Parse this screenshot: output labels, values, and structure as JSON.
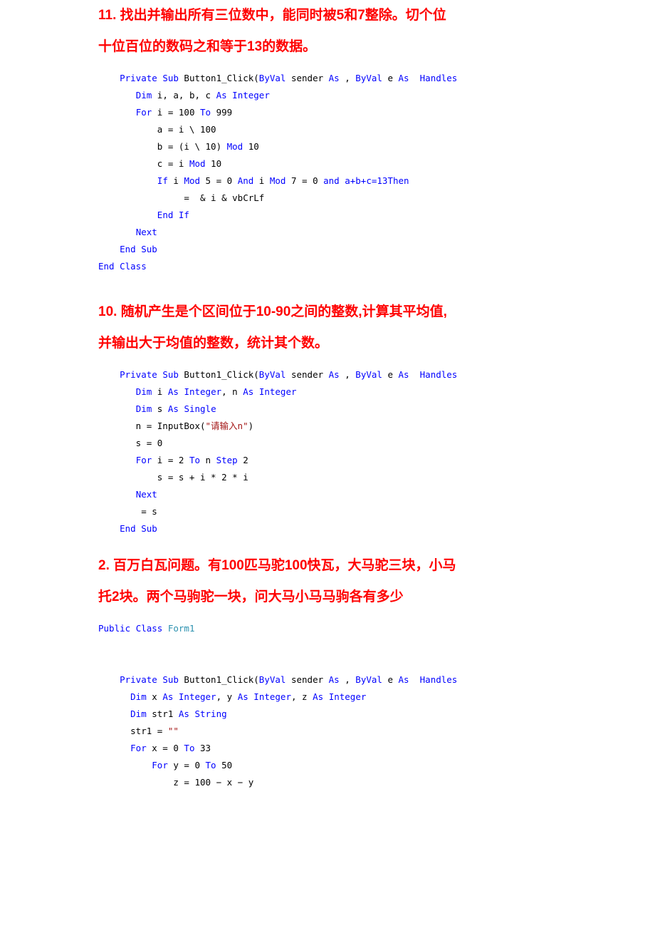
{
  "document": {
    "background": "#ffffff",
    "accent_heading_color": "#FF0000",
    "keyword_color": "#0000FF",
    "type_color": "#2B91AF",
    "string_color": "#A31515"
  },
  "sections": [
    {
      "heading_line1": "11. 找出并输出所有三位数中，能同时被5和7整除。切个位",
      "heading_line2": "十位百位的数码之和等于13的数据。",
      "code_lines": [
        [
          {
            "t": "    ",
            "c": "pl"
          },
          {
            "t": "Private",
            "c": "kw"
          },
          {
            "t": " ",
            "c": "pl"
          },
          {
            "t": "Sub",
            "c": "kw"
          },
          {
            "t": " Button1_Click(",
            "c": "pl"
          },
          {
            "t": "ByVal",
            "c": "kw"
          },
          {
            "t": " sender ",
            "c": "pl"
          },
          {
            "t": "As",
            "c": "kw"
          },
          {
            "t": " , ",
            "c": "pl"
          },
          {
            "t": "ByVal",
            "c": "kw"
          },
          {
            "t": " e ",
            "c": "pl"
          },
          {
            "t": "As",
            "c": "kw"
          },
          {
            "t": "  ",
            "c": "pl"
          },
          {
            "t": "Handles",
            "c": "kw"
          }
        ],
        [
          {
            "t": "       ",
            "c": "pl"
          },
          {
            "t": "Dim",
            "c": "kw"
          },
          {
            "t": " i, a, b, c ",
            "c": "pl"
          },
          {
            "t": "As",
            "c": "kw"
          },
          {
            "t": " ",
            "c": "pl"
          },
          {
            "t": "Integer",
            "c": "kw"
          }
        ],
        [
          {
            "t": "       ",
            "c": "pl"
          },
          {
            "t": "For",
            "c": "kw"
          },
          {
            "t": " i = 100 ",
            "c": "pl"
          },
          {
            "t": "To",
            "c": "kw"
          },
          {
            "t": " 999",
            "c": "pl"
          }
        ],
        [
          {
            "t": "           a = i \\ 100",
            "c": "pl"
          }
        ],
        [
          {
            "t": "           b = (i \\ 10) ",
            "c": "pl"
          },
          {
            "t": "Mod",
            "c": "kw"
          },
          {
            "t": " 10",
            "c": "pl"
          }
        ],
        [
          {
            "t": "           c = i ",
            "c": "pl"
          },
          {
            "t": "Mod",
            "c": "kw"
          },
          {
            "t": " 10",
            "c": "pl"
          }
        ],
        [
          {
            "t": "           ",
            "c": "pl"
          },
          {
            "t": "If",
            "c": "kw"
          },
          {
            "t": " i ",
            "c": "pl"
          },
          {
            "t": "Mod",
            "c": "kw"
          },
          {
            "t": " 5 = 0 ",
            "c": "pl"
          },
          {
            "t": "And",
            "c": "kw"
          },
          {
            "t": " i ",
            "c": "pl"
          },
          {
            "t": "Mod",
            "c": "kw"
          },
          {
            "t": " 7 = 0 ",
            "c": "pl"
          },
          {
            "t": "and",
            "c": "kw"
          },
          {
            "t": " ",
            "c": "pl"
          },
          {
            "t": "a+b+c=13Then",
            "c": "kw"
          }
        ],
        [
          {
            "t": "                =  & i & vbCrLf",
            "c": "pl"
          }
        ],
        [
          {
            "t": "           ",
            "c": "pl"
          },
          {
            "t": "End",
            "c": "kw"
          },
          {
            "t": " ",
            "c": "pl"
          },
          {
            "t": "If",
            "c": "kw"
          }
        ],
        [
          {
            "t": "       ",
            "c": "pl"
          },
          {
            "t": "Next",
            "c": "kw"
          }
        ],
        [
          {
            "t": "    ",
            "c": "pl"
          },
          {
            "t": "End",
            "c": "kw"
          },
          {
            "t": " ",
            "c": "pl"
          },
          {
            "t": "Sub",
            "c": "kw"
          }
        ],
        [
          {
            "t": "End",
            "c": "kw"
          },
          {
            "t": " ",
            "c": "pl"
          },
          {
            "t": "Class",
            "c": "kw"
          }
        ]
      ]
    },
    {
      "heading_line1": "10. 随机产生是个区间位于10-90之间的整数,计算其平均值,",
      "heading_line2": "并输出大于均值的整数，统计其个数。",
      "code_lines": [
        [
          {
            "t": "    ",
            "c": "pl"
          },
          {
            "t": "Private",
            "c": "kw"
          },
          {
            "t": " ",
            "c": "pl"
          },
          {
            "t": "Sub",
            "c": "kw"
          },
          {
            "t": " Button1_Click(",
            "c": "pl"
          },
          {
            "t": "ByVal",
            "c": "kw"
          },
          {
            "t": " sender ",
            "c": "pl"
          },
          {
            "t": "As",
            "c": "kw"
          },
          {
            "t": " , ",
            "c": "pl"
          },
          {
            "t": "ByVal",
            "c": "kw"
          },
          {
            "t": " e ",
            "c": "pl"
          },
          {
            "t": "As",
            "c": "kw"
          },
          {
            "t": "  ",
            "c": "pl"
          },
          {
            "t": "Handles",
            "c": "kw"
          }
        ],
        [
          {
            "t": "       ",
            "c": "pl"
          },
          {
            "t": "Dim",
            "c": "kw"
          },
          {
            "t": " i ",
            "c": "pl"
          },
          {
            "t": "As",
            "c": "kw"
          },
          {
            "t": " ",
            "c": "pl"
          },
          {
            "t": "Integer",
            "c": "kw"
          },
          {
            "t": ", n ",
            "c": "pl"
          },
          {
            "t": "As",
            "c": "kw"
          },
          {
            "t": " ",
            "c": "pl"
          },
          {
            "t": "Integer",
            "c": "kw"
          }
        ],
        [
          {
            "t": "       ",
            "c": "pl"
          },
          {
            "t": "Dim",
            "c": "kw"
          },
          {
            "t": " s ",
            "c": "pl"
          },
          {
            "t": "As",
            "c": "kw"
          },
          {
            "t": " ",
            "c": "pl"
          },
          {
            "t": "Single",
            "c": "kw"
          }
        ],
        [
          {
            "t": "       n = InputBox(",
            "c": "pl"
          },
          {
            "t": "\"请输入n\"",
            "c": "str"
          },
          {
            "t": ")",
            "c": "pl"
          }
        ],
        [
          {
            "t": "       s = 0",
            "c": "pl"
          }
        ],
        [
          {
            "t": "       ",
            "c": "pl"
          },
          {
            "t": "For",
            "c": "kw"
          },
          {
            "t": " i = 2 ",
            "c": "pl"
          },
          {
            "t": "To",
            "c": "kw"
          },
          {
            "t": " n ",
            "c": "pl"
          },
          {
            "t": "Step",
            "c": "kw"
          },
          {
            "t": " 2",
            "c": "pl"
          }
        ],
        [
          {
            "t": "           s = s + i * 2 * i",
            "c": "pl"
          }
        ],
        [
          {
            "t": "       ",
            "c": "pl"
          },
          {
            "t": "Next",
            "c": "kw"
          }
        ],
        [
          {
            "t": "        = s",
            "c": "pl"
          }
        ],
        [
          {
            "t": "    ",
            "c": "pl"
          },
          {
            "t": "End",
            "c": "kw"
          },
          {
            "t": " ",
            "c": "pl"
          },
          {
            "t": "Sub",
            "c": "kw"
          }
        ]
      ]
    },
    {
      "heading_line1": "2. 百万白瓦问题。有100匹马驼100快瓦，大马驼三块，小马",
      "heading_line2": "托2块。两个马驹驼一块，问大马小马马驹各有多少",
      "code_lines": [
        [
          {
            "t": "Public",
            "c": "kw"
          },
          {
            "t": " ",
            "c": "pl"
          },
          {
            "t": "Class",
            "c": "kw"
          },
          {
            "t": " ",
            "c": "pl"
          },
          {
            "t": "Form1",
            "c": "type"
          }
        ],
        [
          {
            "t": "",
            "c": "pl"
          }
        ],
        [
          {
            "t": "",
            "c": "pl"
          }
        ],
        [
          {
            "t": "    ",
            "c": "pl"
          },
          {
            "t": "Private",
            "c": "kw"
          },
          {
            "t": " ",
            "c": "pl"
          },
          {
            "t": "Sub",
            "c": "kw"
          },
          {
            "t": " Button1_Click(",
            "c": "pl"
          },
          {
            "t": "ByVal",
            "c": "kw"
          },
          {
            "t": " sender ",
            "c": "pl"
          },
          {
            "t": "As",
            "c": "kw"
          },
          {
            "t": " , ",
            "c": "pl"
          },
          {
            "t": "ByVal",
            "c": "kw"
          },
          {
            "t": " e ",
            "c": "pl"
          },
          {
            "t": "As",
            "c": "kw"
          },
          {
            "t": "  ",
            "c": "pl"
          },
          {
            "t": "Handles",
            "c": "kw"
          }
        ],
        [
          {
            "t": "      ",
            "c": "pl"
          },
          {
            "t": "Dim",
            "c": "kw"
          },
          {
            "t": " x ",
            "c": "pl"
          },
          {
            "t": "As",
            "c": "kw"
          },
          {
            "t": " ",
            "c": "pl"
          },
          {
            "t": "Integer",
            "c": "kw"
          },
          {
            "t": ", y ",
            "c": "pl"
          },
          {
            "t": "As",
            "c": "kw"
          },
          {
            "t": " ",
            "c": "pl"
          },
          {
            "t": "Integer",
            "c": "kw"
          },
          {
            "t": ", z ",
            "c": "pl"
          },
          {
            "t": "As",
            "c": "kw"
          },
          {
            "t": " ",
            "c": "pl"
          },
          {
            "t": "Integer",
            "c": "kw"
          }
        ],
        [
          {
            "t": "      ",
            "c": "pl"
          },
          {
            "t": "Dim",
            "c": "kw"
          },
          {
            "t": " str1 ",
            "c": "pl"
          },
          {
            "t": "As",
            "c": "kw"
          },
          {
            "t": " ",
            "c": "pl"
          },
          {
            "t": "String",
            "c": "kw"
          }
        ],
        [
          {
            "t": "      str1 = ",
            "c": "pl"
          },
          {
            "t": "\"\"",
            "c": "str"
          }
        ],
        [
          {
            "t": "      ",
            "c": "pl"
          },
          {
            "t": "For",
            "c": "kw"
          },
          {
            "t": " x = 0 ",
            "c": "pl"
          },
          {
            "t": "To",
            "c": "kw"
          },
          {
            "t": " 33",
            "c": "pl"
          }
        ],
        [
          {
            "t": "          ",
            "c": "pl"
          },
          {
            "t": "For",
            "c": "kw"
          },
          {
            "t": " y = 0 ",
            "c": "pl"
          },
          {
            "t": "To",
            "c": "kw"
          },
          {
            "t": " 50",
            "c": "pl"
          }
        ],
        [
          {
            "t": "              z = 100 − x − y",
            "c": "pl"
          }
        ]
      ]
    }
  ]
}
